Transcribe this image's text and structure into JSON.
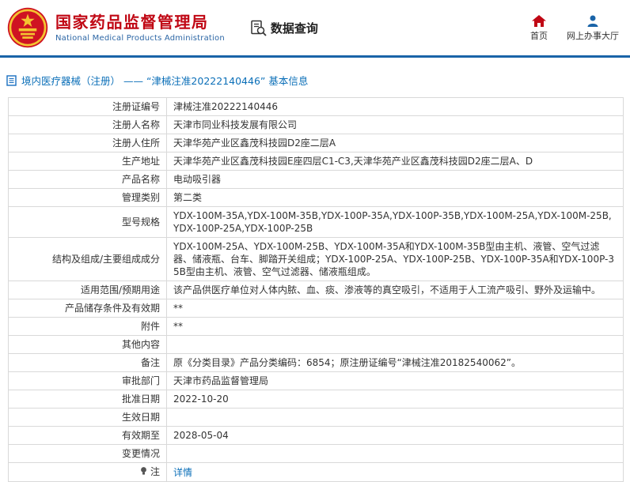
{
  "colors": {
    "brand_red": "#c00714",
    "brand_blue": "#1a64a8",
    "link_blue": "#0b6fb8"
  },
  "header": {
    "agency_cn": "国家药品监督管理局",
    "agency_en": "National Medical Products Administration",
    "section_title": "数据查询",
    "nav": [
      {
        "label": "首页",
        "icon": "home-icon"
      },
      {
        "label": "网上办事大厅",
        "icon": "person-icon"
      }
    ]
  },
  "breadcrumb": {
    "icon": "document-icon",
    "text": "境内医疗器械（注册） ——  “津械注准20222140446” 基本信息"
  },
  "table": {
    "rows": [
      {
        "label": "注册证编号",
        "value": "津械注准20222140446"
      },
      {
        "label": "注册人名称",
        "value": "天津市同业科技发展有限公司"
      },
      {
        "label": "注册人住所",
        "value": "天津华苑产业区鑫茂科技园D2座二层A"
      },
      {
        "label": "生产地址",
        "value": "天津华苑产业区鑫茂科技园E座四层C1-C3,天津华苑产业区鑫茂科技园D2座二层A、D"
      },
      {
        "label": "产品名称",
        "value": "电动吸引器"
      },
      {
        "label": "管理类别",
        "value": "第二类"
      },
      {
        "label": "型号规格",
        "value": "YDX-100M-35A,YDX-100M-35B,YDX-100P-35A,YDX-100P-35B,YDX-100M-25A,YDX-100M-25B,YDX-100P-25A,YDX-100P-25B"
      },
      {
        "label": "结构及组成/主要组成成分",
        "value": "YDX-100M-25A、YDX-100M-25B、YDX-100M-35A和YDX-100M-35B型由主机、液管、空气过滤器、储液瓶、台车、脚踏开关组成；YDX-100P-25A、YDX-100P-25B、YDX-100P-35A和YDX-100P-35B型由主机、液管、空气过滤器、储液瓶组成。"
      },
      {
        "label": "适用范围/预期用途",
        "value": "该产品供医疗单位对人体内脓、血、痰、渗液等的真空吸引，不适用于人工流产吸引、野外及运输中。"
      },
      {
        "label": "产品储存条件及有效期",
        "value": "**"
      },
      {
        "label": "附件",
        "value": "**"
      },
      {
        "label": "其他内容",
        "value": ""
      },
      {
        "label": "备注",
        "value": "原《分类目录》产品分类编码：6854；原注册证编号“津械注准20182540062”。"
      },
      {
        "label": "审批部门",
        "value": "天津市药品监督管理局"
      },
      {
        "label": "批准日期",
        "value": "2022-10-20"
      },
      {
        "label": "生效日期",
        "value": ""
      },
      {
        "label": "有效期至",
        "value": "2028-05-04"
      },
      {
        "label": "变更情况",
        "value": ""
      },
      {
        "label": "注",
        "label_icon": "note-icon",
        "value": "详情",
        "value_is_link": true
      }
    ]
  }
}
